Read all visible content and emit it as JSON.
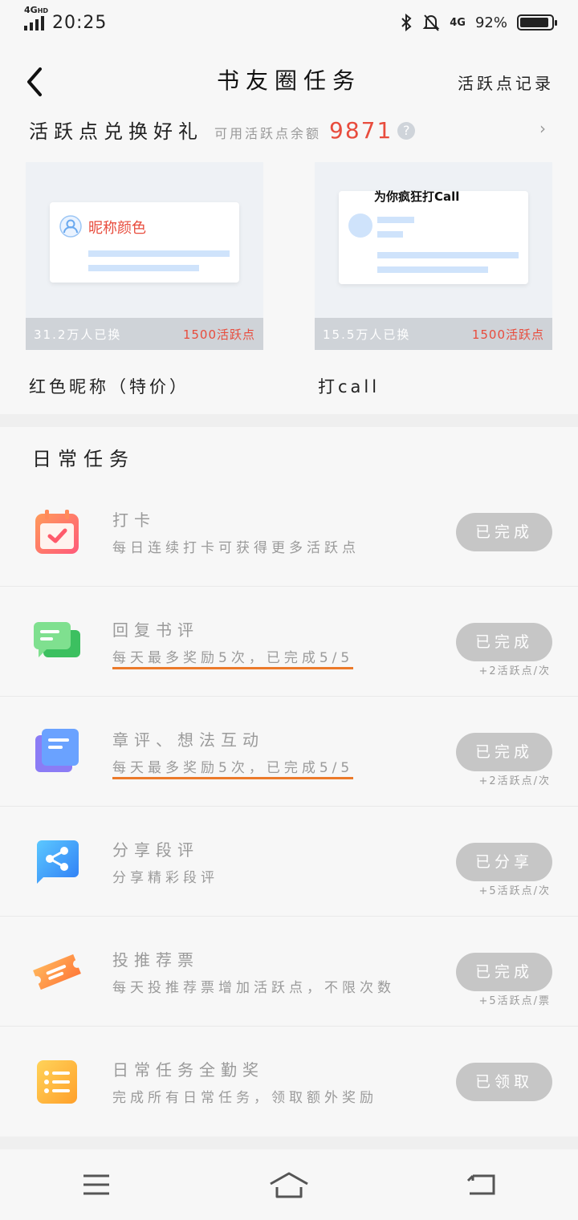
{
  "status": {
    "network": "4G",
    "network_sup": "HD",
    "time": "20:25",
    "net2": "4G",
    "battery": "92%",
    "battery_level": 0.92
  },
  "header": {
    "title": "书友圈任务",
    "right_link": "活跃点记录"
  },
  "redeem": {
    "title": "活跃点兑换好礼",
    "balance_label": "可用活跃点余额",
    "balance_value": "9871",
    "help": "?",
    "gifts": [
      {
        "card_text": "昵称颜色",
        "count": "31.2万人已换",
        "cost": "1500活跃点",
        "name": "红色昵称（特价）"
      },
      {
        "card_text": "为你疯狂打Call",
        "count": "15.5万人已换",
        "cost": "1500活跃点",
        "name": "打call"
      }
    ]
  },
  "daily": {
    "title": "日常任务",
    "tasks": [
      {
        "name": "打卡",
        "desc": "每日连续打卡可获得更多活跃点",
        "button": "已完成",
        "reward": ""
      },
      {
        "name": "回复书评",
        "desc": "每天最多奖励5次，已完成5/5",
        "button": "已完成",
        "reward": "+2活跃点/次"
      },
      {
        "name": "章评、想法互动",
        "desc": "每天最多奖励5次，已完成5/5",
        "button": "已完成",
        "reward": "+2活跃点/次"
      },
      {
        "name": "分享段评",
        "desc": "分享精彩段评",
        "button": "已分享",
        "reward": "+5活跃点/次"
      },
      {
        "name": "投推荐票",
        "desc": "每天投推荐票增加活跃点，不限次数",
        "button": "已完成",
        "reward": "+5活跃点/票"
      },
      {
        "name": "日常任务全勤奖",
        "desc": "完成所有日常任务，领取额外奖励",
        "button": "已领取",
        "reward": ""
      }
    ]
  },
  "colors": {
    "accent_red": "#e84c3d",
    "underline_orange": "#ec7a2a",
    "button_gray": "#c6c6c6"
  }
}
